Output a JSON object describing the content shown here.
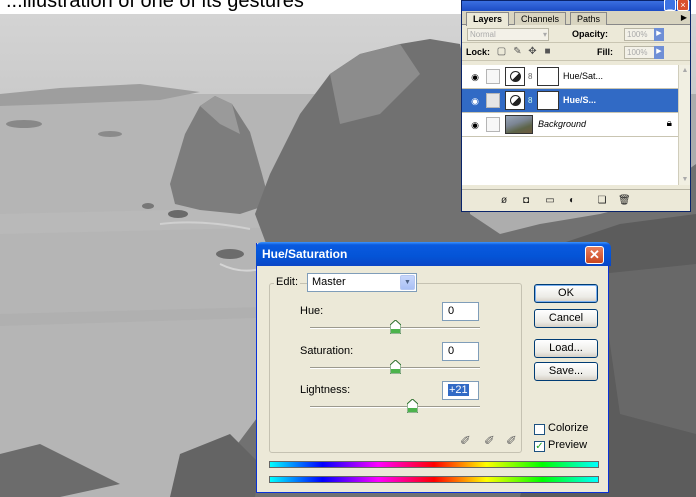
{
  "caption": "...illustration of one of its gestures",
  "layers_panel": {
    "tabs": [
      {
        "label": "Layers",
        "active": true
      },
      {
        "label": "Channels",
        "active": false
      },
      {
        "label": "Paths",
        "active": false
      }
    ],
    "blend_mode": "Normal",
    "opacity_label": "Opacity:",
    "opacity_value": "100%",
    "lock_label": "Lock:",
    "fill_label": "Fill:",
    "fill_value": "100%",
    "layers": [
      {
        "name": "Hue/Sat...",
        "type": "adjustment",
        "selected": false
      },
      {
        "name": "Hue/S...",
        "type": "adjustment",
        "selected": true
      },
      {
        "name": "Background",
        "type": "image",
        "selected": false,
        "locked": true
      }
    ]
  },
  "dialog": {
    "title": "Hue/Saturation",
    "edit_label": "Edit:",
    "edit_value": "Master",
    "fields": [
      {
        "label": "Hue:",
        "value": "0",
        "slider_fraction": 0.5
      },
      {
        "label": "Saturation:",
        "value": "0",
        "slider_fraction": 0.5
      },
      {
        "label": "Lightness:",
        "value": "+21",
        "slider_fraction": 0.605
      }
    ],
    "buttons": {
      "ok": "OK",
      "cancel": "Cancel",
      "load": "Load...",
      "save": "Save..."
    },
    "colorize_label": "Colorize",
    "colorize_checked": false,
    "preview_label": "Preview",
    "preview_checked": true
  }
}
